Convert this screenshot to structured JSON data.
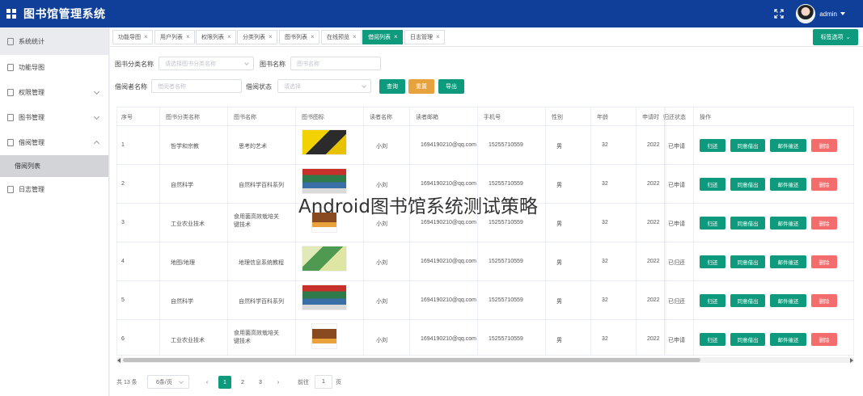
{
  "app": {
    "title": "图书馆管理系统",
    "user": "admin"
  },
  "sidebar": {
    "items": [
      {
        "label": "系统统计",
        "active": true
      },
      {
        "label": "功能导图"
      },
      {
        "label": "权限管理",
        "expandable": true
      },
      {
        "label": "图书管理",
        "expandable": true
      },
      {
        "label": "借阅管理",
        "expandable": true,
        "expanded": true,
        "sub": "借阅列表"
      },
      {
        "label": "日志管理"
      }
    ]
  },
  "tabs": {
    "items": [
      "功能导图",
      "用户列表",
      "权限列表",
      "分类列表",
      "图书列表",
      "在线预览",
      "借阅列表",
      "日志管理"
    ],
    "active": "借阅列表",
    "close_symbol": "×",
    "options_label": "标签选项"
  },
  "filters": {
    "category_label": "图书分类名称",
    "category_placeholder": "请选择图书分类名称",
    "book_label": "图书名称",
    "book_placeholder": "图书名称",
    "borrower_label": "借阅者名称",
    "borrower_placeholder": "借阅者名称",
    "status_label": "借阅状态",
    "status_placeholder": "请选择",
    "query_button": "查询",
    "reset_button": "重置",
    "export_button": "导出"
  },
  "table": {
    "headers": [
      "序号",
      "图书分类名称",
      "图书名称",
      "图书图标",
      "读者名称",
      "读者邮箱",
      "手机号",
      "性别",
      "年龄",
      "申请时",
      "归还状态",
      "操作"
    ],
    "actions": [
      "归还",
      "同意借出",
      "邮件催还",
      "删除"
    ],
    "rows": [
      {
        "no": "1",
        "category": "哲学和宗教",
        "book": "思考的艺术",
        "reader": "小刘",
        "email": "1694190210@qq.com",
        "phone": "15255710559",
        "gender": "男",
        "age": "32",
        "applied": "2022",
        "status": "已申请"
      },
      {
        "no": "2",
        "category": "自然科学",
        "book": "自然科学百科系列",
        "reader": "小刘",
        "email": "1694190210@qq.com",
        "phone": "15255710559",
        "gender": "男",
        "age": "32",
        "applied": "2022",
        "status": "已申请"
      },
      {
        "no": "3",
        "category": "工业农业技术",
        "book": "食用菌高效栽培关键技术",
        "reader": "小刘",
        "email": "1694190210@qq.com",
        "phone": "15255710559",
        "gender": "男",
        "age": "32",
        "applied": "2022",
        "status": "已申请"
      },
      {
        "no": "4",
        "category": "地图/地理",
        "book": "地理信息系统教程",
        "reader": "小刘",
        "email": "1694190210@qq.com",
        "phone": "15255710559",
        "gender": "男",
        "age": "32",
        "applied": "2022",
        "status": "已归还"
      },
      {
        "no": "5",
        "category": "自然科学",
        "book": "自然科学百科系列",
        "reader": "小刘",
        "email": "1694190210@qq.com",
        "phone": "15255710559",
        "gender": "男",
        "age": "32",
        "applied": "2022",
        "status": "已归还"
      },
      {
        "no": "6",
        "category": "工业农业技术",
        "book": "食用菌高效栽培关键技术",
        "reader": "小刘",
        "email": "1694190210@qq.com",
        "phone": "15255710559",
        "gender": "男",
        "age": "32",
        "applied": "2022",
        "status": "已申请"
      }
    ]
  },
  "pagination": {
    "total": "共 13 条",
    "page_size": "6条/页",
    "prev": "‹",
    "next": "›",
    "pages": [
      "1",
      "2",
      "3"
    ],
    "current": "1",
    "goto_label": "前往",
    "goto_value": "1",
    "page_unit": "页"
  },
  "watermark": "Android图书馆系统测试策略",
  "colors": {
    "header": "#0f3f98",
    "primary": "#0e9a7c",
    "warning": "#e6a23c",
    "danger": "#f56c6c"
  }
}
